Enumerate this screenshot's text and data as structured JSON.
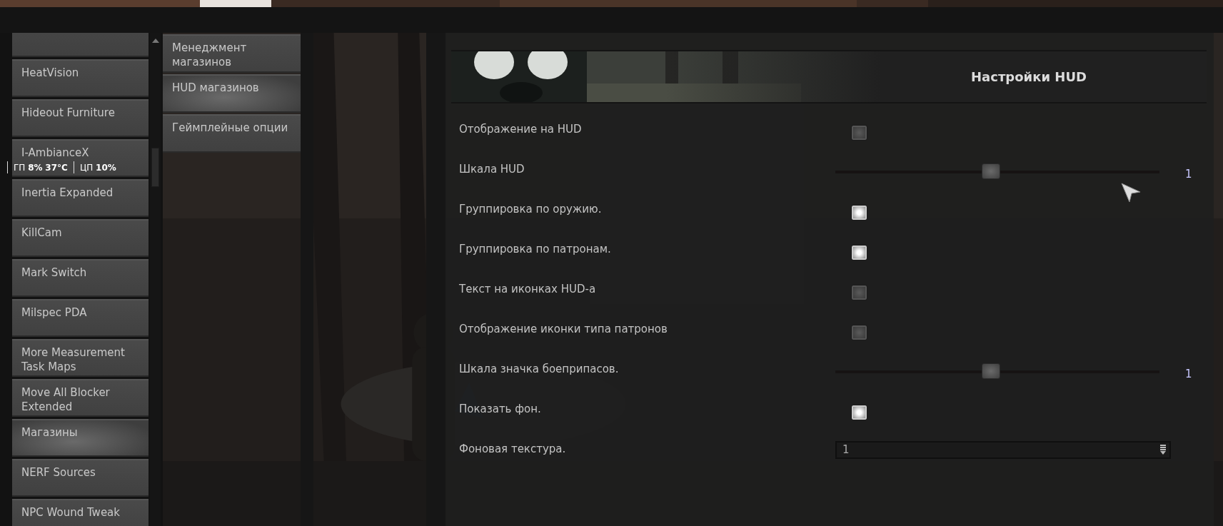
{
  "mods_list": {
    "clipped_top": true,
    "items": [
      {
        "label": "HeatVision",
        "selected": false
      },
      {
        "label": "Hideout Furniture",
        "selected": false
      },
      {
        "label": "I-AmbianceX",
        "selected": false
      },
      {
        "label": "Inertia Expanded",
        "selected": false
      },
      {
        "label": "KillCam",
        "selected": false
      },
      {
        "label": "Mark Switch",
        "selected": false
      },
      {
        "label": "Milspec PDA",
        "selected": false
      },
      {
        "label": "More Measurement Task Maps",
        "selected": false
      },
      {
        "label": "Move All Blocker Extended",
        "selected": false
      },
      {
        "label": "Магазины",
        "selected": true
      },
      {
        "label": "NERF Sources",
        "selected": false
      },
      {
        "label": "NPC Wound Tweak",
        "selected": false
      }
    ]
  },
  "hardware_overlay": {
    "gpu": "ГП **8%** **37°C**",
    "cpu": "ЦП **10%**"
  },
  "submenu": [
    {
      "label": "Менеджмент магазинов",
      "selected": false
    },
    {
      "label": "HUD магазинов",
      "selected": true
    },
    {
      "label": "Геймплейные опции",
      "selected": false
    }
  ],
  "panel": {
    "title": "Настройки HUD",
    "settings": [
      {
        "kind": "checkbox",
        "label": "Отображение на HUD",
        "checked": false
      },
      {
        "kind": "slider",
        "label": "Шкала HUD",
        "level": 0.48,
        "value": "1"
      },
      {
        "kind": "checkbox",
        "label": "Группировка по оружию.",
        "checked": true
      },
      {
        "kind": "checkbox",
        "label": "Группировка по патронам.",
        "checked": true
      },
      {
        "kind": "checkbox",
        "label": "Текст на иконках HUD-а",
        "checked": false
      },
      {
        "kind": "checkbox",
        "label": "Отображение иконки типа патронов",
        "checked": false
      },
      {
        "kind": "slider",
        "label": "Шкала значка боеприпасов.",
        "level": 0.48,
        "value": "1"
      },
      {
        "kind": "checkbox",
        "label": "Показать фон.",
        "checked": true
      },
      {
        "kind": "dropdown",
        "label": "Фоновая текстура.",
        "value": "1"
      }
    ]
  }
}
